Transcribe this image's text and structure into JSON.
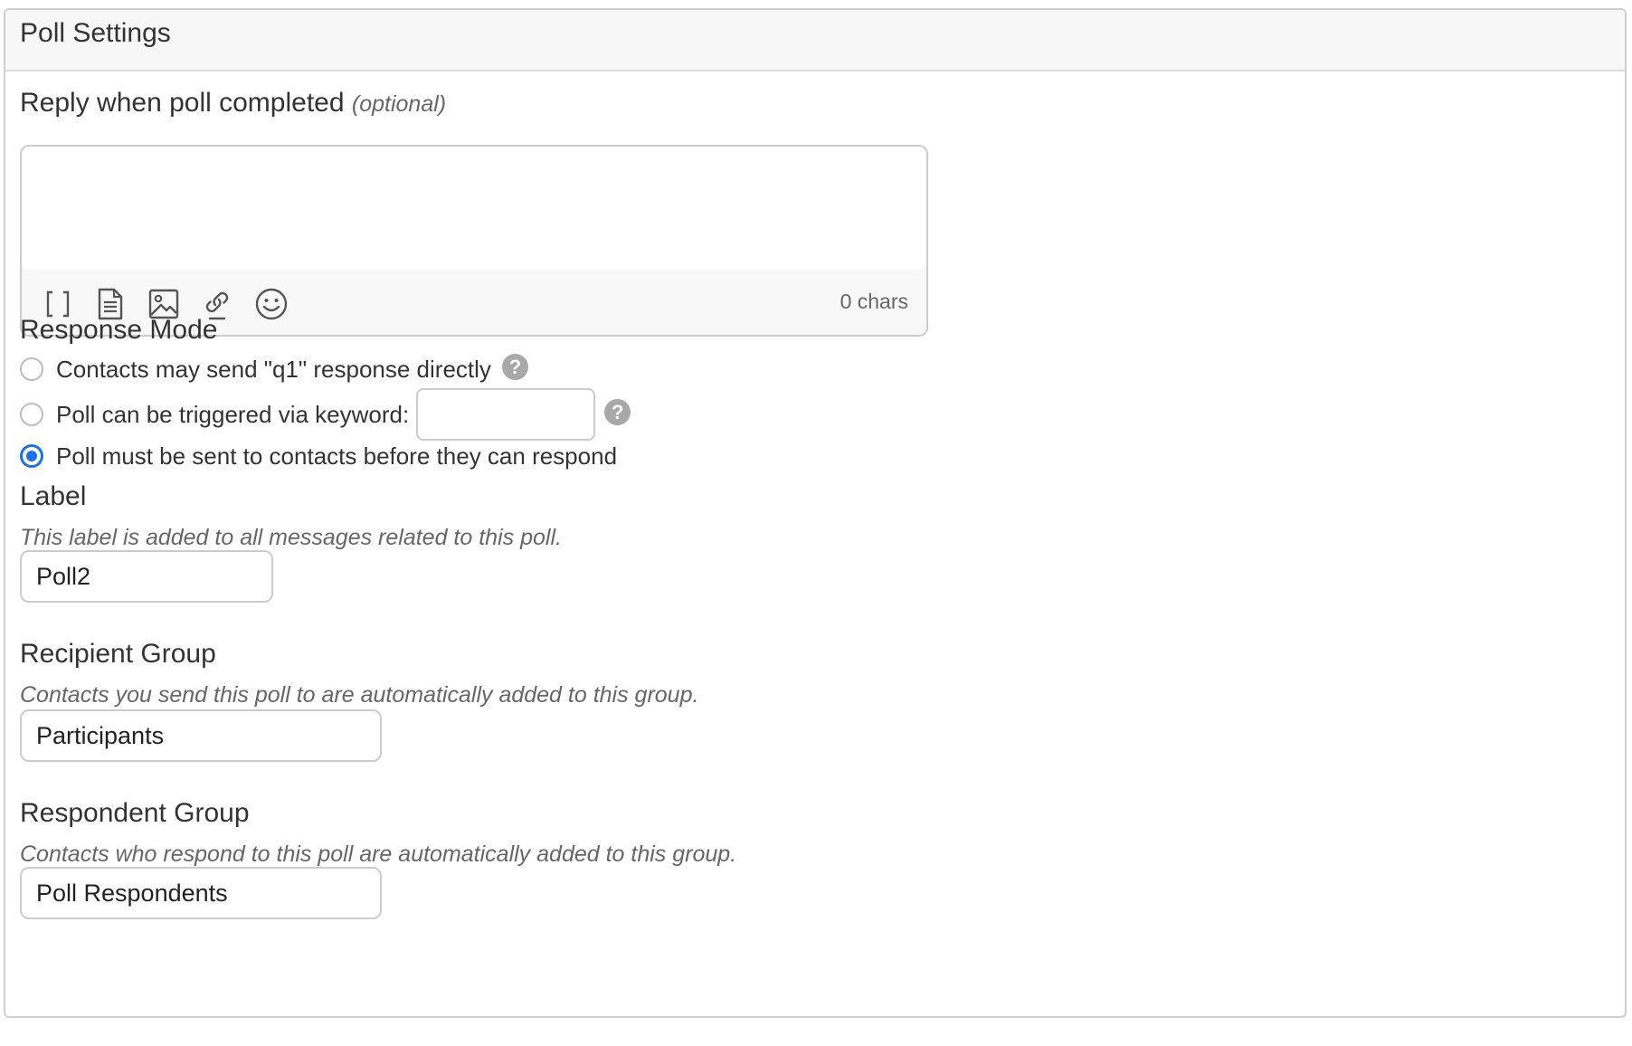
{
  "panel": {
    "title": "Poll Settings"
  },
  "reply": {
    "label": "Reply when poll completed",
    "optional": "(optional)",
    "value": "",
    "char_count": "0 chars",
    "toolbar_icons": [
      "brackets-icon",
      "document-icon",
      "image-icon",
      "link-icon",
      "emoji-icon"
    ]
  },
  "response_mode": {
    "title": "Response Mode",
    "options": [
      {
        "label": "Contacts may send \"q1\" response directly",
        "checked": false
      },
      {
        "label": "Poll can be triggered via keyword:",
        "checked": false,
        "input_value": ""
      },
      {
        "label": "Poll must be sent to contacts before they can respond",
        "checked": true
      }
    ],
    "help_icon": "?"
  },
  "label_section": {
    "title": "Label",
    "hint": "This label is added to all messages related to this poll.",
    "value": "Poll2"
  },
  "recipient_group": {
    "title": "Recipient Group",
    "hint": "Contacts you send this poll to are automatically added to this group.",
    "value": "Participants"
  },
  "respondent_group": {
    "title": "Respondent Group",
    "hint": "Contacts who respond to this poll are automatically added to this group.",
    "value": "Poll Respondents"
  },
  "colors": {
    "accent": "#1a73e8",
    "border": "#cccccc",
    "header_bg": "#f7f7f7",
    "help_icon": "#a8a8a8"
  }
}
